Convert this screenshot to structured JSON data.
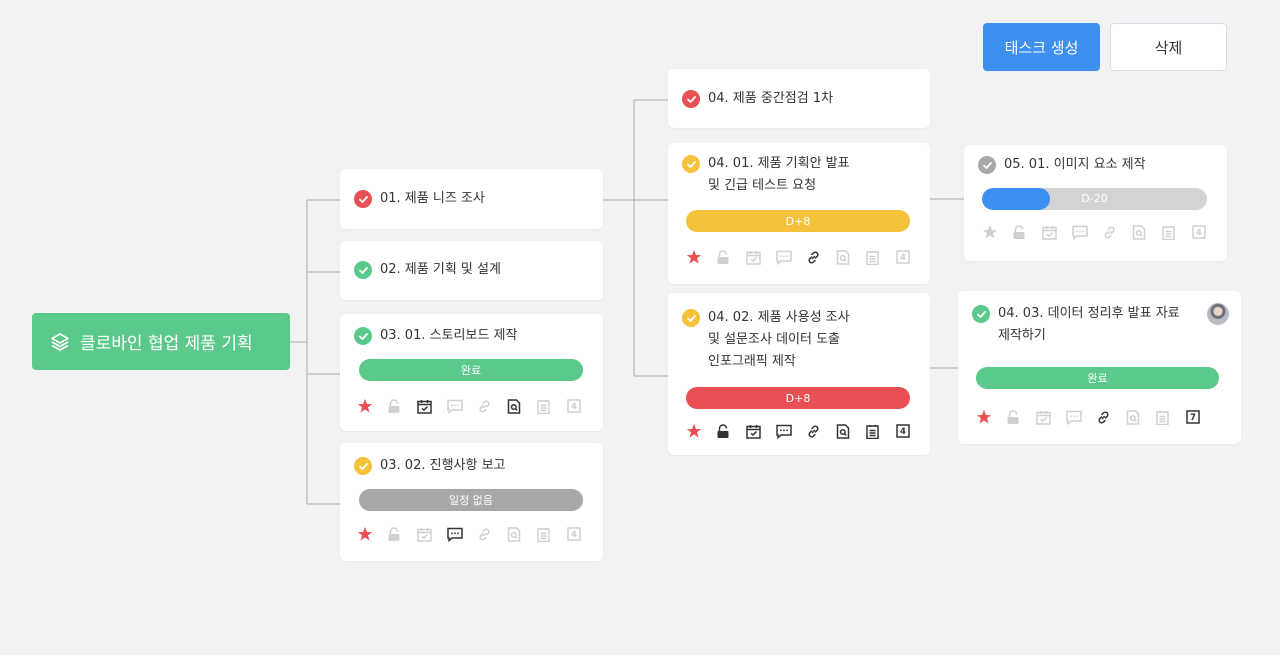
{
  "toolbar": {
    "create_label": "태스크 생성",
    "delete_label": "삭제"
  },
  "root": {
    "label": "클로바인 협업 제품 기획"
  },
  "colors": {
    "green": "#5cc98c",
    "red": "#e95055",
    "yellow": "#f5c33b",
    "gray": "#a8a8a8",
    "blue": "#3d8ff0",
    "icon_inactive": "#d0d0d4",
    "icon_active": "#333333"
  },
  "cards": [
    {
      "id": "c01",
      "title": "01. 제품 니즈 조사",
      "status": "red"
    },
    {
      "id": "c02",
      "title": "02. 제품 기획 및 설계",
      "status": "green"
    },
    {
      "id": "c0301",
      "title": "03. 01. 스토리보드 제작",
      "status": "green",
      "bar": {
        "text": "완료",
        "color": "green"
      },
      "icons": {
        "star": true,
        "lock": false,
        "calendar": true,
        "comment": false,
        "link": false,
        "search": true,
        "doc": false,
        "count": false
      }
    },
    {
      "id": "c0302",
      "title": "03. 02. 진행사항 보고",
      "status": "yellow",
      "bar": {
        "text": "일정 없음",
        "color": "gray"
      },
      "icons": {
        "star": true,
        "lock": false,
        "calendar": false,
        "comment": true,
        "link": false,
        "search": false,
        "doc": false,
        "count": false
      }
    },
    {
      "id": "c04",
      "title": "04. 제품 중간점검 1차",
      "status": "red"
    },
    {
      "id": "c0401",
      "title": [
        "04. 01. 제품 기획안 발표",
        "및 긴급 테스트 요청"
      ],
      "status": "yellow",
      "bar": {
        "text": "D+8",
        "color": "yellow"
      },
      "icons": {
        "star": true,
        "lock": false,
        "calendar": false,
        "comment": false,
        "link": true,
        "search": false,
        "doc": false,
        "count": false
      }
    },
    {
      "id": "c0402",
      "title": [
        "04. 02. 제품 사용성 조사",
        "및 설문조사 데이터 도출",
        "인포그래픽 제작"
      ],
      "status": "yellow",
      "bar": {
        "text": "D+8",
        "color": "red"
      },
      "icons": {
        "star": true,
        "lock": true,
        "calendar": true,
        "comment": true,
        "link": true,
        "search": true,
        "doc": true,
        "count": true
      }
    },
    {
      "id": "c0501",
      "title": "05. 01. 이미지 요소 제작",
      "status": "gray",
      "progress": {
        "text": "D-20",
        "fraction": 0.3
      },
      "icons": {
        "star": false,
        "lock": false,
        "calendar": false,
        "comment": false,
        "link": false,
        "search": false,
        "doc": false,
        "count": false
      }
    },
    {
      "id": "c0403",
      "title": [
        "04. 03. 데이터 정리후 발표 자료",
        "제작하기"
      ],
      "status": "green",
      "bar": {
        "text": "완료",
        "color": "green"
      },
      "icons": {
        "star": true,
        "lock": false,
        "calendar": false,
        "comment": false,
        "link": true,
        "search": false,
        "doc": false,
        "count": true
      }
    }
  ],
  "counts": {
    "default": "4",
    "c0403": "7"
  }
}
